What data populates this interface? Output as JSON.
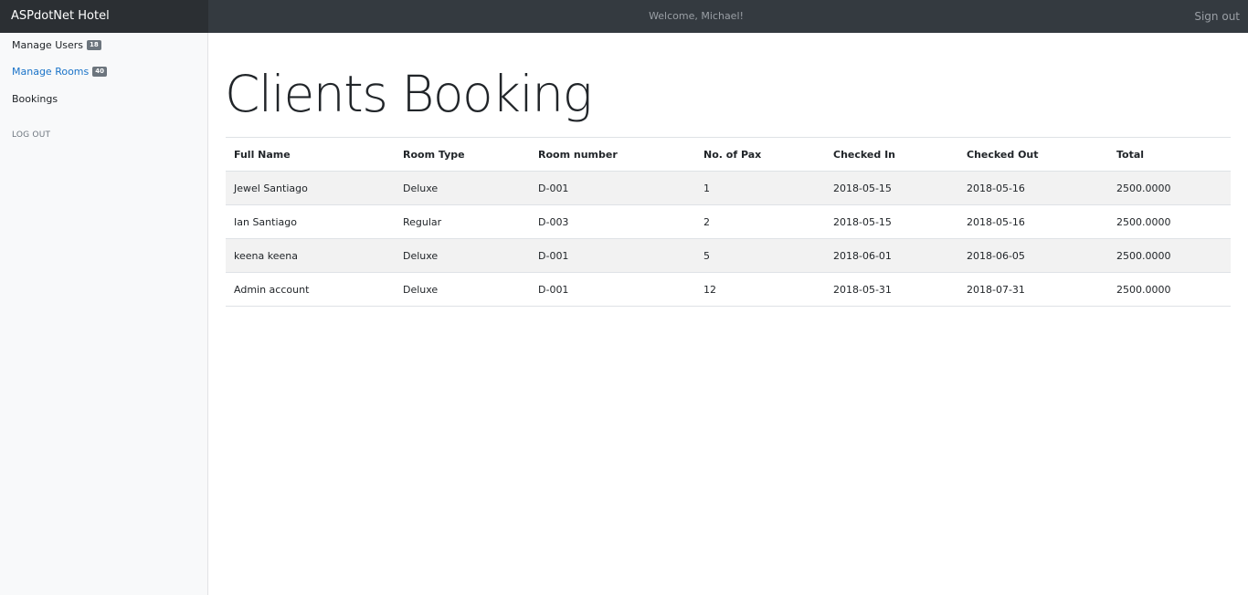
{
  "header": {
    "brand": "ASPdotNet Hotel",
    "welcome": "Welcome, Michael!",
    "sign_out": "Sign out"
  },
  "sidebar": {
    "items": [
      {
        "label": "Manage Users",
        "badge": "18"
      },
      {
        "label": "Manage Rooms",
        "badge": "40"
      },
      {
        "label": "Bookings"
      }
    ],
    "log_out": "LOG OUT"
  },
  "main": {
    "title": "Clients Booking",
    "table": {
      "headers": [
        "Full Name",
        "Room Type",
        "Room number",
        "No. of Pax",
        "Checked In",
        "Checked Out",
        "Total"
      ],
      "rows": [
        [
          "Jewel Santiago",
          "Deluxe",
          "D-001",
          "1",
          "2018-05-15",
          "2018-05-16",
          "2500.0000"
        ],
        [
          "Ian Santiago",
          "Regular",
          "D-003",
          "2",
          "2018-05-15",
          "2018-05-16",
          "2500.0000"
        ],
        [
          "keena keena",
          "Deluxe",
          "D-001",
          "5",
          "2018-06-01",
          "2018-06-05",
          "2500.0000"
        ],
        [
          "Admin account",
          "Deluxe",
          "D-001",
          "12",
          "2018-05-31",
          "2018-07-31",
          "2500.0000"
        ]
      ]
    }
  },
  "colors": {
    "topbar": "#343a40",
    "brand_bg": "#2b2f33",
    "active_link": "#1a73c8",
    "badge": "#6c757d",
    "stripe": "#f2f2f2"
  }
}
